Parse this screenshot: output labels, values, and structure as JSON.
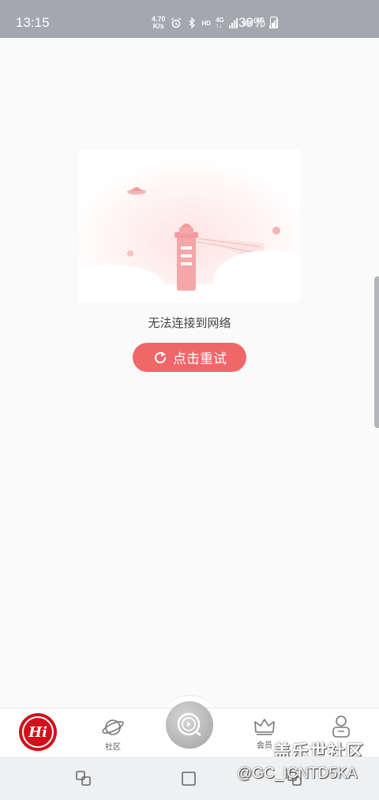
{
  "status_bar": {
    "time": "13:15",
    "net_speed_value": "4.70",
    "net_speed_unit": "K/s",
    "hd1": "HD",
    "net1": "4G",
    "hd2": "HD",
    "net2": "4G",
    "battery": "39%"
  },
  "main": {
    "error_message": "无法连接到网络",
    "retry_label": "点击重试",
    "accent_color": "#f06768"
  },
  "bottom_nav": {
    "logo_text": "Hi",
    "items": [
      {
        "label": "社区",
        "icon": "planet-icon"
      },
      {
        "label": "会员",
        "icon": "crown-icon"
      },
      {
        "label": "",
        "icon": "profile-icon"
      }
    ],
    "center_icon": "play-icon"
  },
  "watermark": {
    "title": "盖乐世社区",
    "handle": "@GC_ICNTD5KA"
  }
}
